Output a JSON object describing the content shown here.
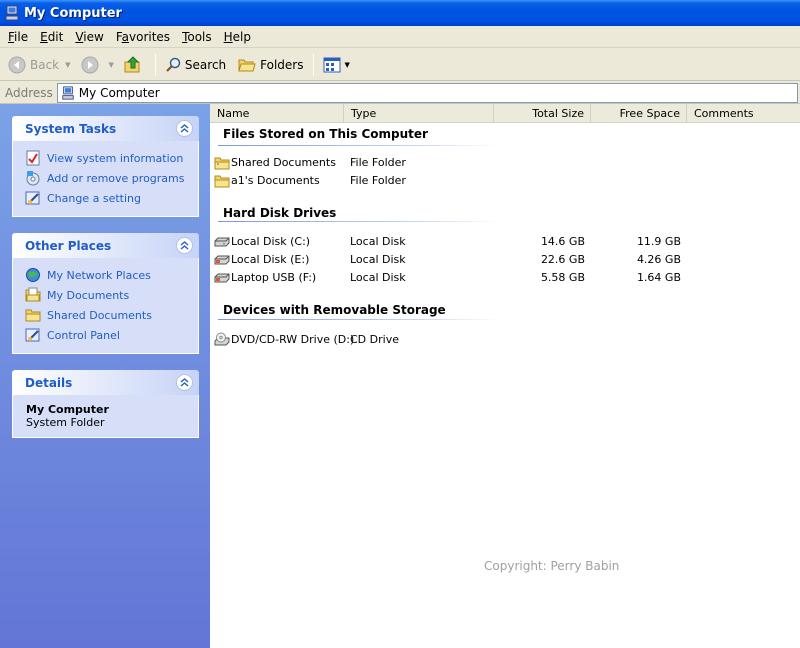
{
  "window": {
    "title": "My Computer"
  },
  "menu": [
    {
      "label": "File",
      "u": "F",
      "rest": "ile"
    },
    {
      "label": "Edit",
      "u": "E",
      "rest": "dit"
    },
    {
      "label": "View",
      "u": "V",
      "rest": "iew"
    },
    {
      "label": "Favorites",
      "u": "",
      "pre": "F",
      "u2": "a",
      "rest": "vorites"
    },
    {
      "label": "Tools",
      "u": "T",
      "rest": "ools"
    },
    {
      "label": "Help",
      "u": "H",
      "rest": "elp"
    }
  ],
  "toolbar": {
    "back": "Back",
    "search": "Search",
    "folders": "Folders"
  },
  "address": {
    "label": "Address",
    "value": "My Computer"
  },
  "left": {
    "system_tasks": {
      "title": "System Tasks",
      "items": [
        "View system information",
        "Add or remove programs",
        "Change a setting"
      ]
    },
    "other_places": {
      "title": "Other Places",
      "items": [
        "My Network Places",
        "My Documents",
        "Shared Documents",
        "Control Panel"
      ]
    },
    "details": {
      "title": "Details",
      "name": "My Computer",
      "subtitle": "System Folder"
    }
  },
  "columns": [
    "Name",
    "Type",
    "Total Size",
    "Free Space",
    "Comments"
  ],
  "groups": {
    "files": {
      "title": "Files Stored on This Computer",
      "items": [
        {
          "name": "Shared Documents",
          "type": "File Folder"
        },
        {
          "name": "a1's Documents",
          "type": "File Folder"
        }
      ]
    },
    "hdd": {
      "title": "Hard Disk Drives",
      "items": [
        {
          "name": "Local Disk (C:)",
          "type": "Local Disk",
          "total": "14.6 GB",
          "free": "11.9 GB"
        },
        {
          "name": "Local Disk (E:)",
          "type": "Local Disk",
          "total": "22.6 GB",
          "free": "4.26 GB"
        },
        {
          "name": "Laptop USB (F:)",
          "type": "Local Disk",
          "total": "5.58 GB",
          "free": "1.64 GB"
        }
      ]
    },
    "removable": {
      "title": "Devices with Removable Storage",
      "items": [
        {
          "name": "DVD/CD-RW Drive (D:)",
          "type": "CD Drive"
        }
      ]
    }
  },
  "watermark": "Copyright: Perry Babin",
  "colors": {
    "title_bar": "#0054e3",
    "left_pane_top": "#7ba2e7",
    "left_pane_bottom": "#6375d6",
    "link": "#215dc6"
  }
}
